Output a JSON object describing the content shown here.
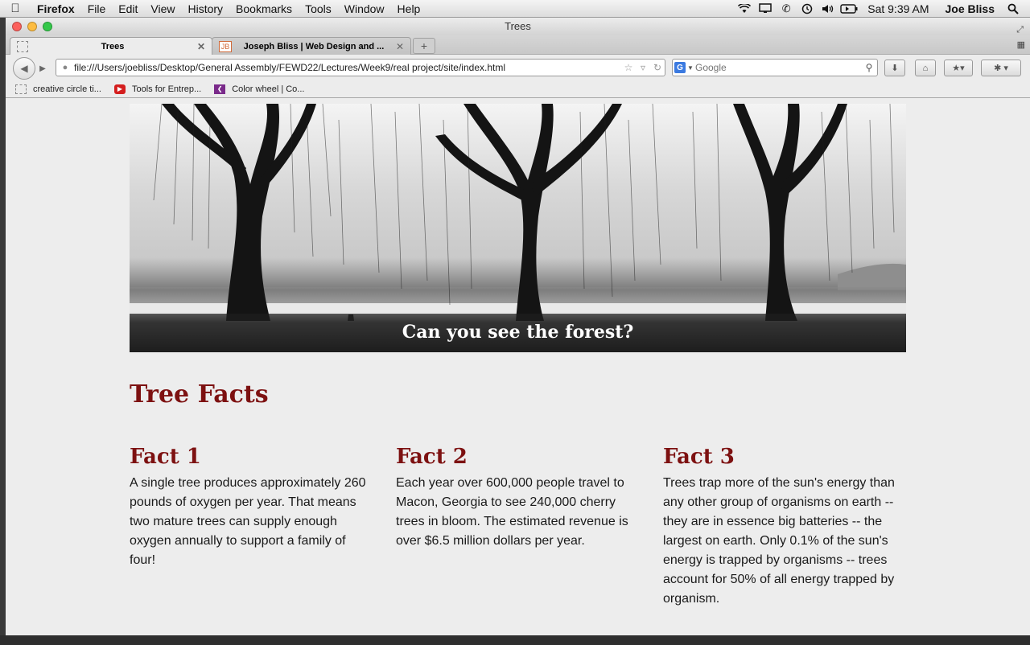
{
  "menubar": {
    "app": "Firefox",
    "items": [
      "File",
      "Edit",
      "View",
      "History",
      "Bookmarks",
      "Tools",
      "Window",
      "Help"
    ],
    "clock": "Sat 9:39 AM",
    "user": "Joe Bliss"
  },
  "window": {
    "title": "Trees"
  },
  "tabs": [
    {
      "label": "Trees",
      "active": true
    },
    {
      "label": "Joseph Bliss | Web Design and ...",
      "favicon": "JB",
      "active": false
    }
  ],
  "navbar": {
    "url": "file:///Users/joebliss/Desktop/General Assembly/FEWD22/Lectures/Week9/real project/site/index.html",
    "search_placeholder": "Google",
    "search_engine": "G"
  },
  "bookmarks": [
    {
      "label": "creative circle ti...",
      "icon": "blank-page-icon"
    },
    {
      "label": "Tools for Entrep...",
      "icon": "youtube-icon"
    },
    {
      "label": "Color wheel | Co...",
      "icon": "color-wheel-icon"
    }
  ],
  "page": {
    "hero_caption": "Can you see the forest?",
    "section_title": "Tree Facts",
    "facts": [
      {
        "title": "Fact 1",
        "text": "A single tree produces approximately 260 pounds of oxygen per year. That means two mature trees can supply enough oxygen annually to support a family of four!"
      },
      {
        "title": "Fact 2",
        "text": "Each year over 600,000 people travel to Macon, Georgia to see 240,000 cherry trees in bloom. The estimated revenue is over $6.5 million dollars per year."
      },
      {
        "title": "Fact 3",
        "text": "Trees trap more of the sun's energy than any other group of organisms on earth -- they are in essence big batteries -- the largest on earth. Only 0.1% of the sun's energy is trapped by organisms -- trees account for 50% of all energy trapped by organism."
      }
    ]
  },
  "colors": {
    "heading": "#7d1111",
    "page_bg": "#ededed"
  }
}
